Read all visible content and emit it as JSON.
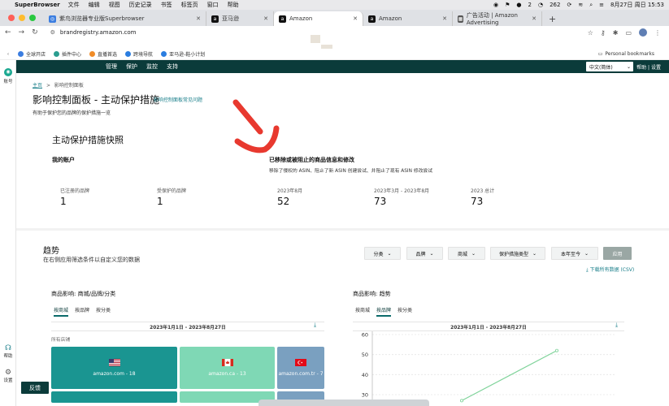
{
  "menubar": {
    "app_name": "SuperBrowser",
    "items": [
      "文件",
      "编辑",
      "视图",
      "历史记录",
      "书签",
      "标签页",
      "窗口",
      "帮助"
    ],
    "status_badge_count": "2",
    "notification_count": "262",
    "datetime": "8月27日 周日  15:53"
  },
  "tabs": [
    {
      "title": "紫鸟浏览器专业版Superbrowser",
      "color": "#3b7de0",
      "glyph": "◎"
    },
    {
      "title": "亚马逊",
      "color": "#111111",
      "glyph": "a"
    },
    {
      "title": "Amazon",
      "color": "#111111",
      "glyph": "a"
    },
    {
      "title": "Amazon",
      "color": "#111111",
      "glyph": "a"
    },
    {
      "title": "广告活动 | Amazon Advertising",
      "color": "#555555",
      "glyph": "▦"
    }
  ],
  "url": "brandregistry.amazon.com",
  "bookmarks": {
    "items": [
      {
        "label": "全球开店",
        "color": "#3b7de0"
      },
      {
        "label": "插件中心",
        "color": "#2a9d8f"
      },
      {
        "label": "直播首选",
        "color": "#f08c28"
      },
      {
        "label": "跨境导航",
        "color": "#2a7de0"
      },
      {
        "label": "亚马逊-鞋小计划",
        "color": "#2a7de0"
      }
    ],
    "personal": "Personal bookmarks"
  },
  "sidebar": {
    "account": "账号",
    "help": "帮助",
    "settings": "设置"
  },
  "topnav": {
    "items": [
      "管理",
      "保护",
      "监控",
      "支持"
    ],
    "language": "中文(简体)",
    "help": "帮助",
    "settings": "设置"
  },
  "breadcrumb": {
    "home": "主页",
    "sep": ">",
    "current": "影响控制面板"
  },
  "page": {
    "title": "影响控制面板 - 主动保护措施",
    "faq": "影响控制面板常见问题",
    "subtitle": "有助于保护您的品牌的保护措施一览"
  },
  "snapshot": {
    "title": "主动保护措施快照",
    "my_account": "我的账户",
    "removed_title": "已移除或被阻止的商品信息和修改",
    "removed_desc": "移除了侵权的 ASIN、阻止了新 ASIN 创建尝试、并阻止了现有 ASIN 修改尝试",
    "stats": [
      {
        "label": "已注册的品牌",
        "value": "1"
      },
      {
        "label": "受保护的品牌",
        "value": "1"
      },
      {
        "label": "2023年8月",
        "value": "52"
      },
      {
        "label": "2023年3月 - 2023年8月",
        "value": "73"
      },
      {
        "label": "2023 总计",
        "value": "73"
      }
    ]
  },
  "trends": {
    "title": "趋势",
    "subtitle": "在右侧应用筛选条件以自定义您的数据",
    "filters": [
      "分类",
      "品牌",
      "商城",
      "保护措施类型",
      "本年至今"
    ],
    "apply": "应用",
    "csv": "下载所有数据 (CSV)"
  },
  "left_panel": {
    "title": "商品影响:  商城/品牌/分类",
    "tabs": [
      "按商城",
      "按品牌",
      "按分类"
    ],
    "active_tab": 0,
    "date_range": "2023年1月1日 - 2023年8月27日",
    "all_stores": "所有店铺",
    "tiles": [
      {
        "label": "amazon.com - 18",
        "color": "#1a9591",
        "flag": "us"
      },
      {
        "label": "amazon.ca - 13",
        "color": "#7fd8b5",
        "flag": "ca"
      },
      {
        "label": "amazon.com.tr - 7",
        "color": "#7aa0c0",
        "flag": "tr"
      }
    ]
  },
  "right_panel": {
    "title": "商品影响:  趋势",
    "tabs": [
      "按商城",
      "按品牌",
      "按分类"
    ],
    "active_tab": 1,
    "date_range": "2023年1月1日 - 2023年8月27日"
  },
  "chart_data": {
    "type": "line",
    "y_ticks": [
      "60",
      "50",
      "40",
      "30"
    ],
    "ylim": [
      30,
      60
    ],
    "x": [
      0,
      1
    ],
    "series": [
      {
        "values": [
          27,
          52
        ]
      }
    ],
    "color": "#7fd39a",
    "grid": true
  },
  "feedback": "反馈"
}
